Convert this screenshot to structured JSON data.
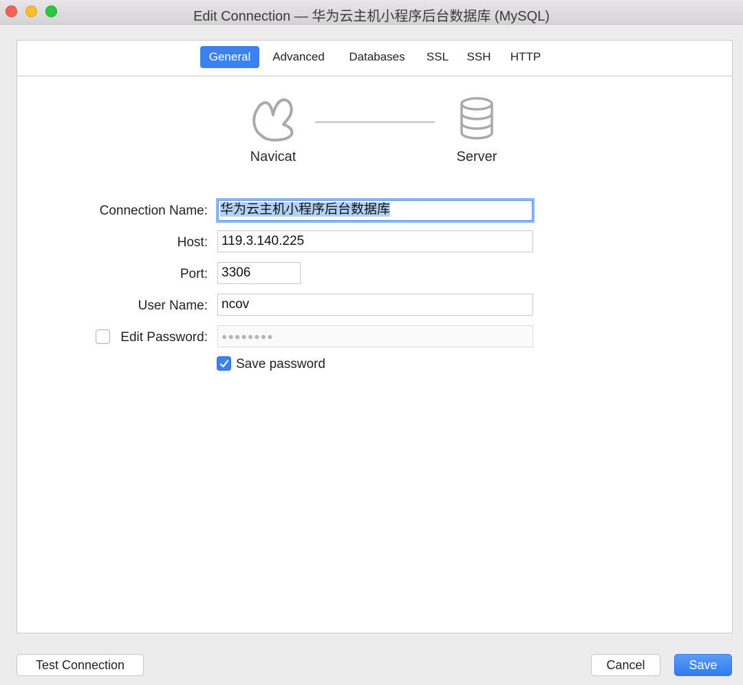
{
  "window": {
    "title": "Edit Connection — 华为云主机小程序后台数据库 (MySQL)"
  },
  "tabs": [
    {
      "label": "General",
      "active": true
    },
    {
      "label": "Advanced",
      "active": false
    },
    {
      "label": "Databases",
      "active": false
    },
    {
      "label": "SSL",
      "active": false
    },
    {
      "label": "SSH",
      "active": false
    },
    {
      "label": "HTTP",
      "active": false
    }
  ],
  "diagram": {
    "client_label": "Navicat",
    "server_label": "Server",
    "client_icon": "navicat-logo-icon",
    "server_icon": "database-icon"
  },
  "form": {
    "connection_name_label": "Connection Name:",
    "connection_name_value": "华为云主机小程序后台数据库",
    "host_label": "Host:",
    "host_value": "119.3.140.225",
    "port_label": "Port:",
    "port_value": "3306",
    "username_label": "User Name:",
    "username_value": "ncov",
    "edit_password_label": "Edit Password:",
    "edit_password_checked": false,
    "password_value": "●●●●●●●●",
    "save_password_label": "Save password",
    "save_password_checked": true
  },
  "buttons": {
    "test_connection": "Test Connection",
    "cancel": "Cancel",
    "save": "Save"
  },
  "colors": {
    "accent": "#3b82f0",
    "close": "#fe5f57",
    "minimize": "#febc2e",
    "maximize": "#28c840"
  }
}
